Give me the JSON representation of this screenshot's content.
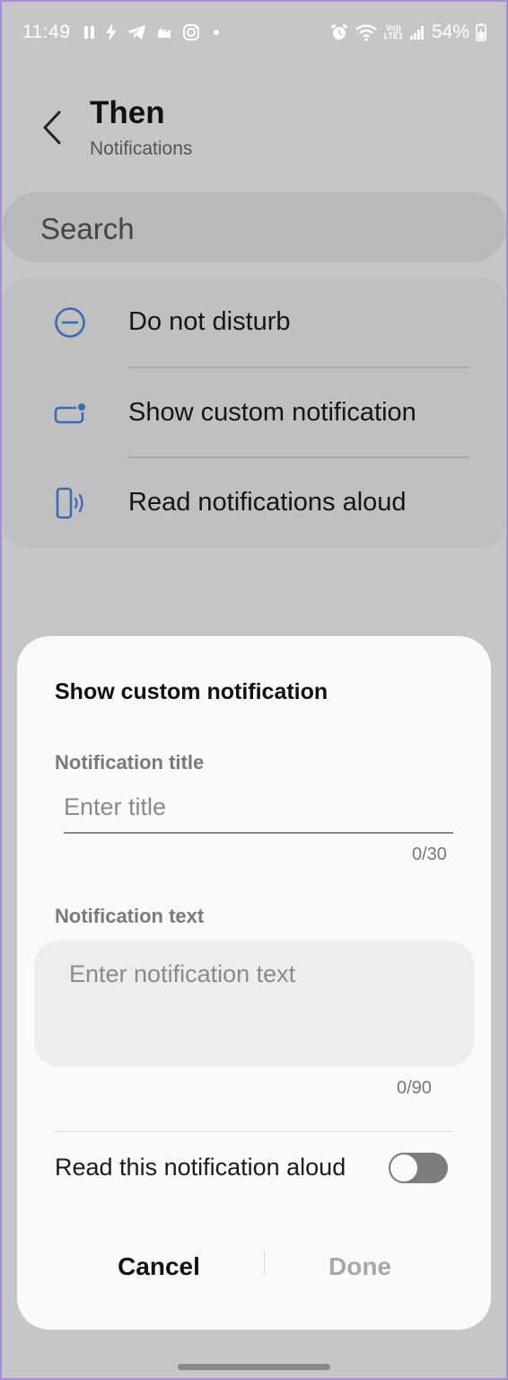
{
  "status_bar": {
    "time": "11:49",
    "battery": "54%",
    "network_label_top": "Vo))",
    "network_label_bottom": "LTE1",
    "left_icons": [
      "pause-icon",
      "bolt-icon",
      "telegram-icon",
      "cloud-icon",
      "instagram-icon",
      "dot-icon"
    ],
    "right_icons": [
      "alarm-icon",
      "wifi-icon",
      "signal-icon",
      "battery-icon"
    ]
  },
  "header": {
    "title": "Then",
    "subtitle": "Notifications"
  },
  "search": {
    "label": "Search"
  },
  "actions": {
    "items": [
      {
        "label": "Do not disturb",
        "icon": "minus-circle-icon"
      },
      {
        "label": "Show custom notification",
        "icon": "notification-card-icon"
      },
      {
        "label": "Read notifications aloud",
        "icon": "phone-speaker-icon"
      }
    ]
  },
  "dialog": {
    "title": "Show custom notification",
    "title_field_label": "Notification title",
    "title_placeholder": "Enter title",
    "title_value": "",
    "title_counter": "0/30",
    "text_field_label": "Notification text",
    "text_placeholder": "Enter notification text",
    "text_value": "",
    "text_counter": "0/90",
    "read_aloud_label": "Read this notification aloud",
    "read_aloud_on": false,
    "cancel_label": "Cancel",
    "done_label": "Done"
  },
  "colors": {
    "accent_blue": "#3a6ab8",
    "dim_background": "#c6c6c6",
    "dialog_background": "#fafafa"
  }
}
